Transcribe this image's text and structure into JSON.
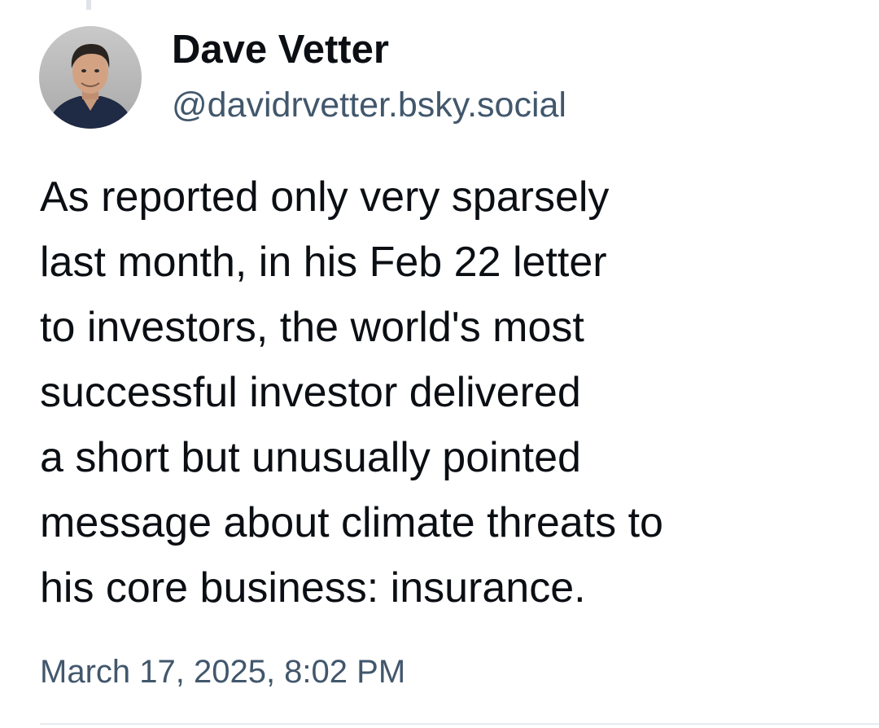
{
  "post": {
    "author": {
      "display_name": "Dave Vetter",
      "handle": "@davidrvetter.bsky.social",
      "avatar_icon": "user-avatar-photo"
    },
    "text_lines": [
      "As reported only very sparsely",
      "last month, in his Feb 22 letter",
      "to investors, the world's most",
      "successful investor delivered",
      "a short but unusually pointed",
      "message about climate threats to",
      "his core business: insurance."
    ],
    "timestamp": "March 17, 2025, 8:02 PM"
  },
  "colors": {
    "text_primary": "#0b0f14",
    "text_secondary": "#42576c",
    "thread_line": "#dfe4ea",
    "divider": "#e6eaee"
  }
}
